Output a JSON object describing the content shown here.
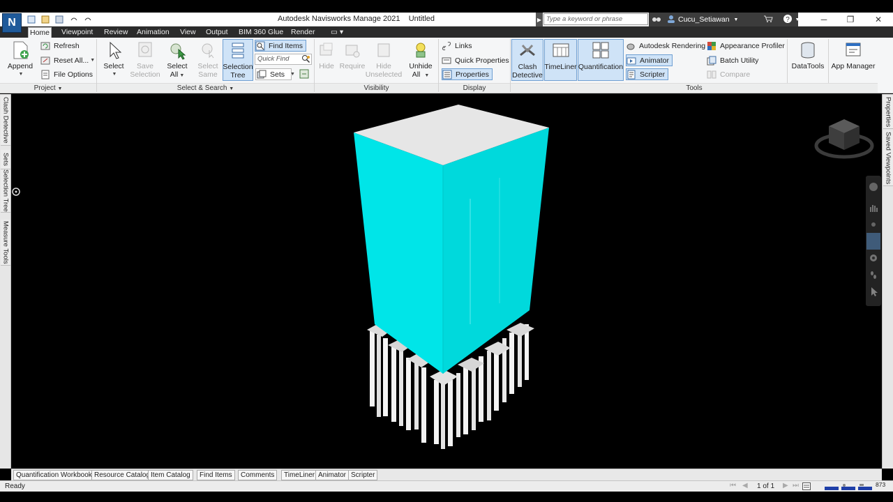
{
  "window": {
    "app_logo": "N",
    "title": "Autodesk Navisworks Manage 2021    Untitled",
    "search_placeholder": "Type a keyword or phrase",
    "user": "Cucu_Setiawan"
  },
  "tabs": [
    "Home",
    "Viewpoint",
    "Review",
    "Animation",
    "View",
    "Output",
    "BIM 360 Glue",
    "Render"
  ],
  "project_panel": {
    "title": "Project",
    "append": "Append",
    "refresh": "Refresh",
    "reset_all": "Reset All...",
    "file_options": "File Options"
  },
  "select_panel": {
    "title": "Select & Search",
    "select": "Select",
    "save_selection_1": "Save",
    "save_selection_2": "Selection",
    "select_all_1": "Select",
    "select_all_2": "All",
    "select_same_1": "Select",
    "select_same_2": "Same",
    "selection_tree_1": "Selection",
    "selection_tree_2": "Tree",
    "find_items": "Find Items",
    "quick_find_placeholder": "Quick Find",
    "sets": "Sets"
  },
  "visibility_panel": {
    "title": "Visibility",
    "hide": "Hide",
    "require": "Require",
    "hide_unselected_1": "Hide",
    "hide_unselected_2": "Unselected",
    "unhide_all_1": "Unhide",
    "unhide_all_2": "All"
  },
  "display_panel": {
    "title": "Display",
    "links": "Links",
    "quick_properties": "Quick Properties",
    "properties": "Properties"
  },
  "tools_panel": {
    "title": "Tools",
    "clash_detective_1": "Clash",
    "clash_detective_2": "Detective",
    "timeliner": "TimeLiner",
    "quantification": "Quantification",
    "autodesk_rendering": "Autodesk Rendering",
    "animator": "Animator",
    "scripter": "Scripter",
    "appearance_profiler": "Appearance Profiler",
    "batch_utility": "Batch Utility",
    "compare": "Compare",
    "datatools": "DataTools",
    "app_manager": "App Manager"
  },
  "left_dock_tabs": [
    "Clash Detective",
    "Sets",
    "Selection Tree",
    "Measure Tools"
  ],
  "right_dock_tabs": [
    "Properties",
    "Saved Viewpoints"
  ],
  "bottom_tabs": [
    "Quantification Workbook",
    "Resource Catalog",
    "Item Catalog",
    "Find Items",
    "Comments",
    "TimeLiner",
    "Animator",
    "Scripter"
  ],
  "status": {
    "text": "Ready",
    "page": "1 of 1",
    "memory": "873"
  },
  "colors": {
    "building_face": "#00e5e8",
    "building_top": "#e6e6e6",
    "piles": "#f2f2f2"
  }
}
